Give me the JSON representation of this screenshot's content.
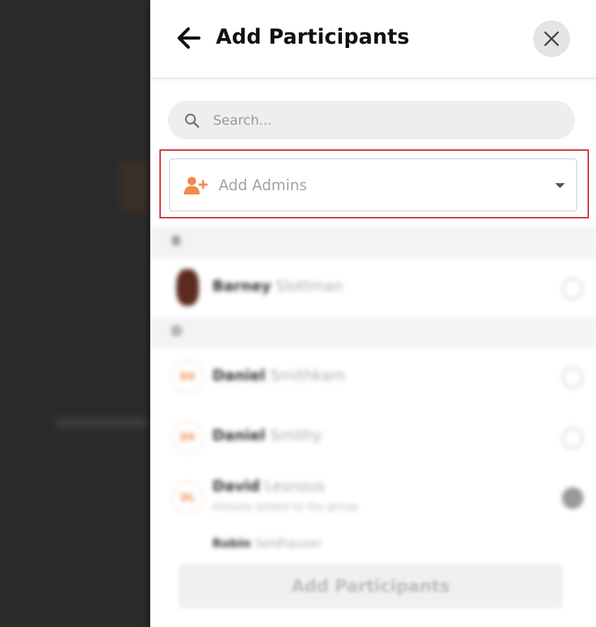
{
  "header": {
    "title": "Add Participants"
  },
  "search": {
    "placeholder": "Search..."
  },
  "admins": {
    "placeholder": "Add Admins"
  },
  "accent_color": "#f28a4a",
  "highlight_color": "#d32f2f",
  "sections": [
    {
      "letter": "B",
      "contacts": [
        {
          "first": "Barney",
          "last": "Slottman",
          "initials": "",
          "selected": false
        }
      ]
    },
    {
      "letter": "D",
      "contacts": [
        {
          "first": "Daniel",
          "last": "Smithkam",
          "initials": "DS",
          "selected": false
        },
        {
          "first": "Daniel",
          "last": "Smithy",
          "initials": "DS",
          "selected": false
        },
        {
          "first": "David",
          "last": "Lesnous",
          "initials": "DL",
          "subtitle": "Already added to the group",
          "selected": true
        },
        {
          "first": "Robin",
          "last": "Seldhauser",
          "initials": "",
          "selected": false
        }
      ]
    }
  ],
  "footer": {
    "button_label": "Add Participants"
  }
}
